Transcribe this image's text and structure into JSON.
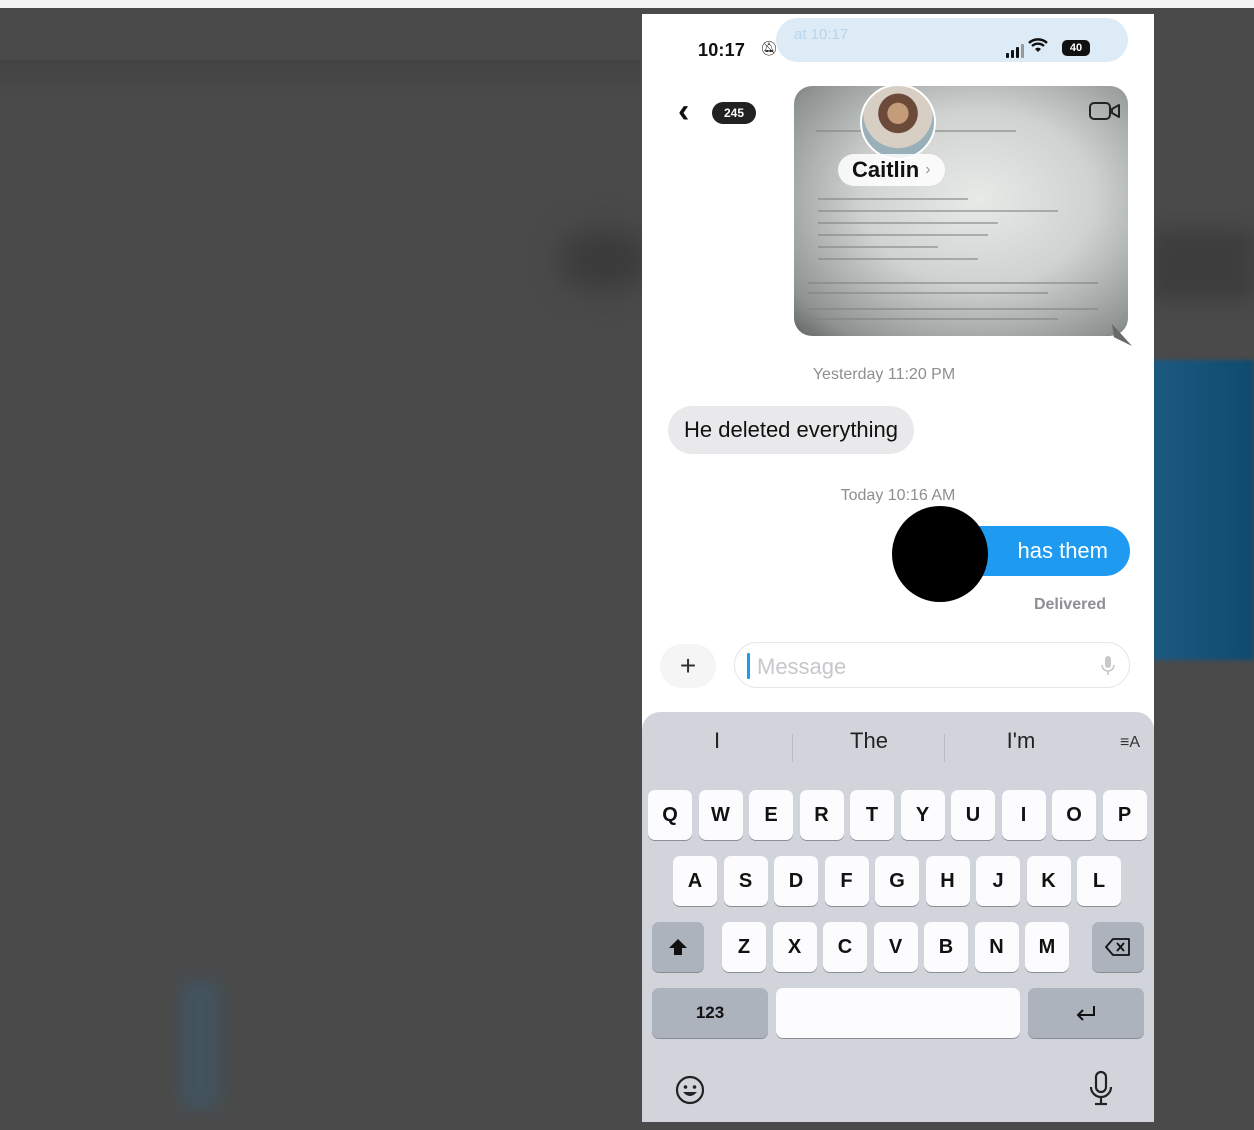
{
  "status_bar": {
    "time": "10:17",
    "notification_text": "at 10:17",
    "battery": "40"
  },
  "header": {
    "back_count": "245",
    "contact_name": "Caitlin"
  },
  "messages": {
    "timestamp_1": "Yesterday 11:20 PM",
    "incoming_text": "He deleted everything",
    "timestamp_2": "Today 10:16 AM",
    "outgoing_text": "has them",
    "delivery_status": "Delivered"
  },
  "composer": {
    "plus_label": "+",
    "placeholder": "Message"
  },
  "keyboard": {
    "suggestions": [
      "I",
      "The",
      "I'm"
    ],
    "row1": [
      "Q",
      "W",
      "E",
      "R",
      "T",
      "Y",
      "U",
      "I",
      "O",
      "P"
    ],
    "row2": [
      "A",
      "S",
      "D",
      "F",
      "G",
      "H",
      "J",
      "K",
      "L"
    ],
    "row3": [
      "Z",
      "X",
      "C",
      "V",
      "B",
      "N",
      "M"
    ],
    "numbers_label": "123",
    "format_label": "≡A"
  },
  "colors": {
    "outgoing_bubble": "#1e9bf0",
    "incoming_bubble": "#e9e9eb",
    "keyboard_bg": "#d1d5db"
  }
}
